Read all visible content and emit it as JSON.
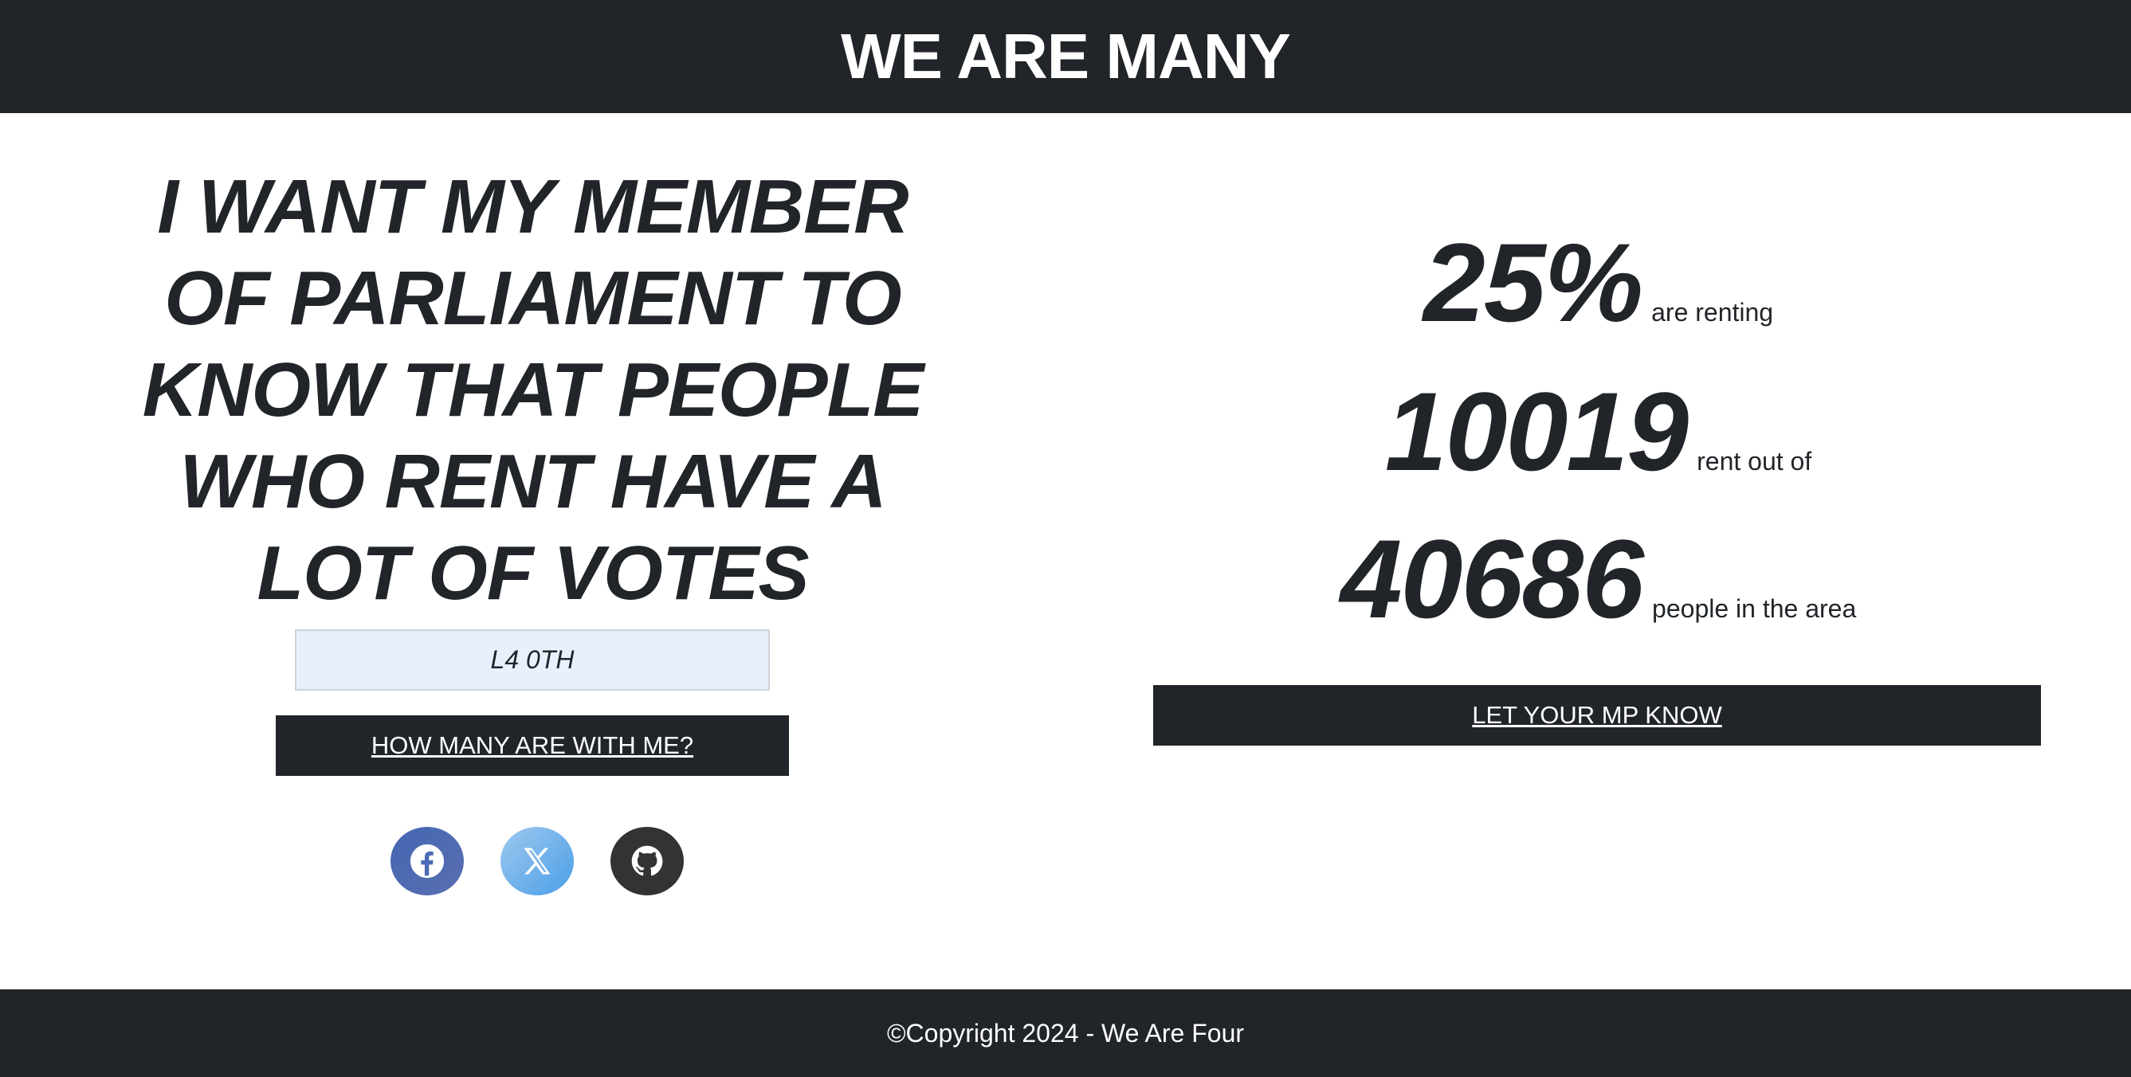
{
  "header": {
    "title": "WE ARE MANY"
  },
  "hero": {
    "headline": "I WANT MY MEMBER OF PARLIAMENT TO KNOW THAT PEOPLE WHO RENT HAVE A LOT OF VOTES",
    "postcode_value": "L4 0TH",
    "how_many_label": "HOW MANY ARE WITH ME?"
  },
  "social": {
    "icons": [
      "facebook-icon",
      "x-twitter-icon",
      "github-icon"
    ],
    "colors": {
      "facebook": "#4267b2",
      "x": "#4a9ee8",
      "github": "#333333"
    }
  },
  "stats": {
    "percent": "25%",
    "percent_label": "are renting",
    "renters": "10019",
    "renters_label": "rent out of",
    "total": "40686",
    "total_label": "people in the area"
  },
  "cta": {
    "let_mp_know_label": "LET YOUR MP KNOW"
  },
  "footer": {
    "copyright": "©Copyright 2024 - We Are Four"
  },
  "theme": {
    "dark": "#212529",
    "input_bg": "#e8f0fe"
  }
}
